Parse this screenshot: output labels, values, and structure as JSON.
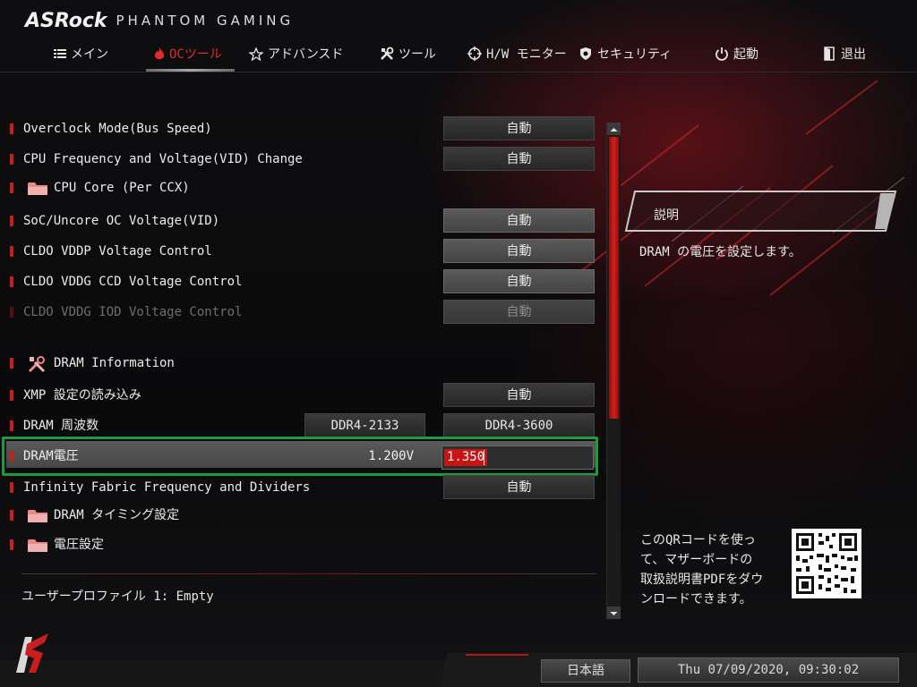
{
  "brand": {
    "name": "ASRock",
    "product": "PHANTOM GAMING"
  },
  "nav": {
    "tabs": [
      {
        "label": "メイン",
        "icon": "list-icon",
        "active": false
      },
      {
        "label": "OCツール",
        "icon": "flame-icon",
        "active": true
      },
      {
        "label": "アドバンスド",
        "icon": "star-icon",
        "active": false
      },
      {
        "label": "ツール",
        "icon": "tools-icon",
        "active": false
      },
      {
        "label": "H/W モニター",
        "icon": "crosshair-icon",
        "active": false
      },
      {
        "label": "セキュリティ",
        "icon": "shield-icon",
        "active": false
      },
      {
        "label": "起動",
        "icon": "power-icon",
        "active": false
      },
      {
        "label": "退出",
        "icon": "exit-icon",
        "active": false
      }
    ]
  },
  "settings": {
    "overclock_mode": {
      "label": "Overclock Mode(Bus Speed)",
      "value": "自動"
    },
    "cpu_freq_vid": {
      "label": "CPU Frequency and Voltage(VID) Change",
      "value": "自動"
    },
    "cpu_core": {
      "label": "CPU Core (Per CCX)"
    },
    "soc_uncore": {
      "label": "SoC/Uncore OC Voltage(VID)",
      "value": "自動"
    },
    "cldo_vddp": {
      "label": "CLDO VDDP Voltage Control",
      "value": "自動"
    },
    "cldo_vddg_ccd": {
      "label": "CLDO VDDG CCD Voltage Control",
      "value": "自動"
    },
    "cldo_vddg_iod": {
      "label": "CLDO VDDG IOD Voltage Control",
      "value": "自動",
      "disabled": true
    },
    "dram_info": {
      "label": "DRAM Information"
    },
    "xmp": {
      "label": "XMP 設定の読み込み",
      "value": "自動"
    },
    "dram_freq": {
      "label": "DRAM 周波数",
      "current": "DDR4-2133",
      "value": "DDR4-3600"
    },
    "dram_voltage": {
      "label": "DRAM電圧",
      "current": "1.200V",
      "value": "1.350"
    },
    "infinity_fabric": {
      "label": "Infinity Fabric Frequency and Dividers",
      "value": "自動"
    },
    "dram_timing": {
      "label": "DRAM タイミング設定"
    },
    "voltage_settings": {
      "label": "電圧設定"
    }
  },
  "profile": {
    "text": "ユーザープロファイル 1: Empty"
  },
  "description": {
    "title": "説明",
    "text": "DRAM の電圧を設定します。"
  },
  "qr": {
    "line1": "このQRコードを使っ",
    "line2": "て、マザーボードの",
    "line3": "取扱説明書PDFをダウ",
    "line4": "ンロードできます。"
  },
  "footer": {
    "language": "日本語",
    "datetime": "Thu 07/09/2020, 09:30:02"
  },
  "colors": {
    "accent": "#c81e1e",
    "selection_outline": "#1f9a3f"
  }
}
